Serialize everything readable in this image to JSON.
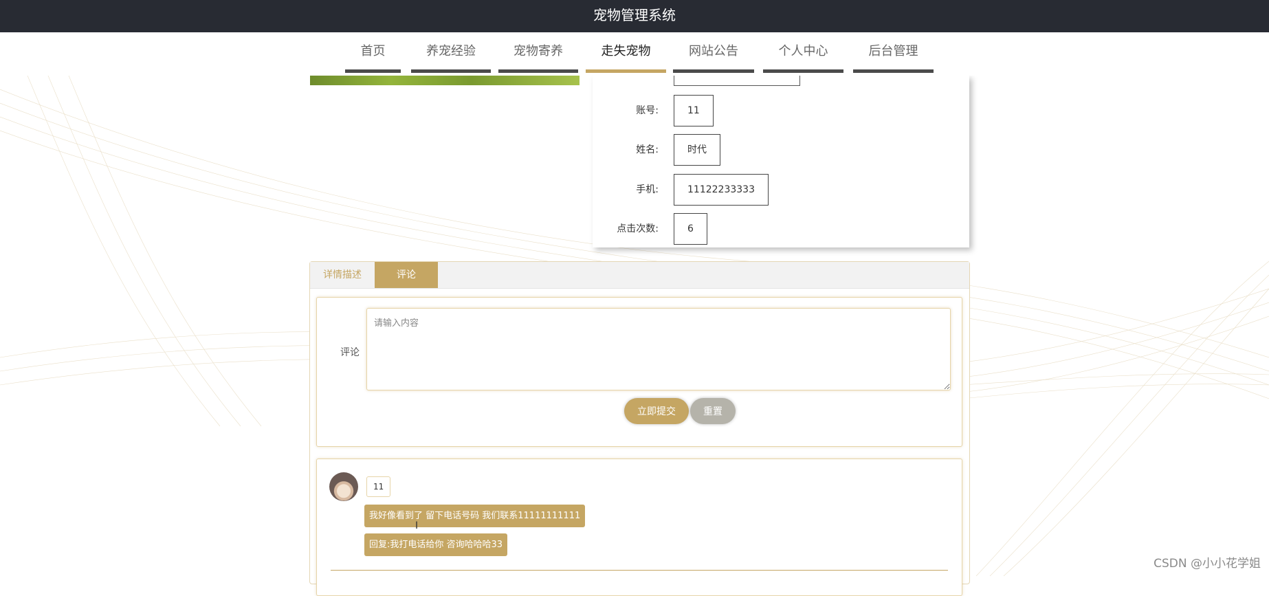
{
  "header": {
    "title": "宠物管理系统"
  },
  "nav": {
    "items": [
      {
        "label": "首页"
      },
      {
        "label": "养宠经验"
      },
      {
        "label": "宠物寄养"
      },
      {
        "label": "走失宠物",
        "active": true
      },
      {
        "label": "网站公告"
      },
      {
        "label": "个人中心"
      },
      {
        "label": "后台管理"
      }
    ]
  },
  "info": {
    "rows": [
      {
        "label": "账号:",
        "value": "11"
      },
      {
        "label": "姓名:",
        "value": "时代"
      },
      {
        "label": "手机:",
        "value": "11122233333"
      },
      {
        "label": "点击次数:",
        "value": "6"
      }
    ]
  },
  "tabs": [
    {
      "label": "详情描述"
    },
    {
      "label": "评论",
      "active": true
    }
  ],
  "comment_form": {
    "label": "评论",
    "placeholder": "请输入内容",
    "submit_label": "立即提交",
    "reset_label": "重置"
  },
  "comments": [
    {
      "username": "11",
      "messages": [
        "我好像看到了 留下电话号码 我们联系11111111111",
        "回复:我打电话给你 咨询哈哈哈33"
      ]
    }
  ],
  "watermark": "CSDN @小小花学姐",
  "colors": {
    "accent": "#c5a663",
    "header_bg": "#282b33",
    "nav_underline": "#4b4b4b",
    "reset_btn": "#b5b3aa"
  }
}
